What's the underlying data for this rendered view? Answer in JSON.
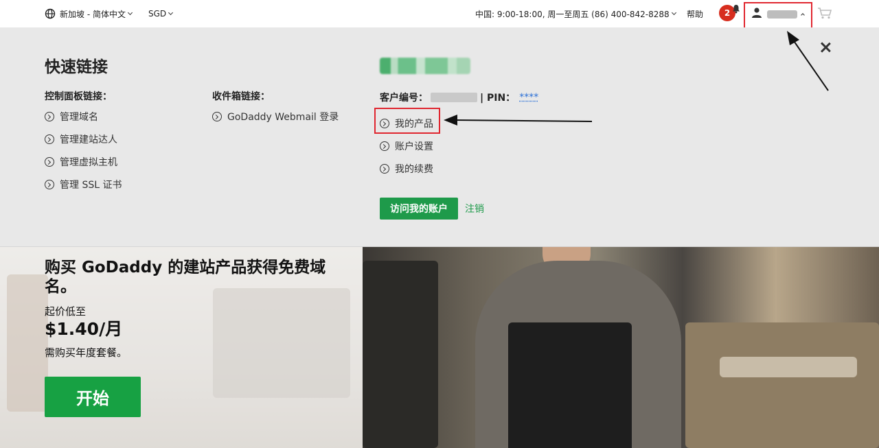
{
  "topbar": {
    "locale": "新加坡 - 简体中文",
    "currency": "SGD",
    "support": "中国: 9:00-18:00, 周一至周五 (86) 400-842-8288",
    "help": "帮助",
    "notification_count": "2",
    "cart_icon": "cart-icon"
  },
  "panel": {
    "title": "快速链接",
    "control_panel_heading": "控制面板链接：",
    "control_panel_links": [
      "管理域名",
      "管理建站达人",
      "管理虚拟主机",
      "管理 SSL 证书"
    ],
    "inbox_heading": "收件箱链接：",
    "inbox_links": [
      "GoDaddy Webmail 登录"
    ],
    "customer_label": "客户编号：",
    "pin_label": "| PIN：",
    "pin_value": "****",
    "account_links": [
      "我的产品",
      "账户设置",
      "我的续费"
    ],
    "visit_account_button": "访问我的账户",
    "logout_link": "注销"
  },
  "hero": {
    "headline_line1": "购买 GoDaddy 的建站产品获得免费域",
    "headline_line2": "名。",
    "price_prefix": "起价低至",
    "price": "$1.40/月",
    "note": "需购买年度套餐。",
    "cta": "开始"
  },
  "colors": {
    "accent_green": "#1e9a4a",
    "badge_red": "#d72e1f",
    "highlight_red": "#e0262f",
    "panel_bg": "#e8e8e8"
  }
}
